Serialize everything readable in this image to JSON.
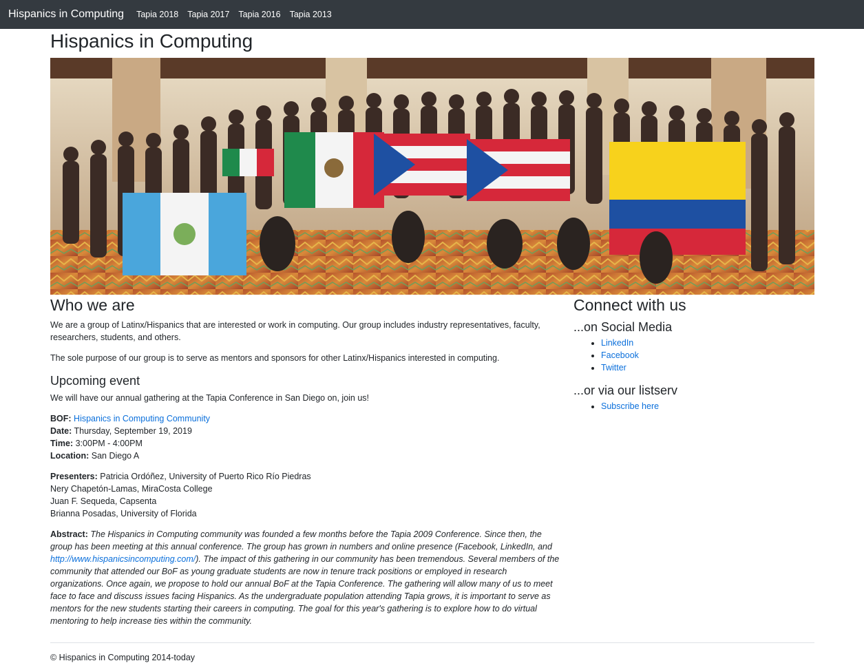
{
  "nav": {
    "brand": "Hispanics in Computing",
    "links": [
      "Tapia 2018",
      "Tapia 2017",
      "Tapia 2016",
      "Tapia 2013"
    ]
  },
  "page": {
    "title": "Hispanics in Computing"
  },
  "hero": {
    "description": "Group photo holding flags"
  },
  "who": {
    "heading": "Who we are",
    "p1": "We are a group of Latinx/Hispanics that are interested or work in computing. Our group includes industry representatives, faculty, researchers, students, and others.",
    "p2": "The sole purpose of our group is to serve as mentors and sponsors for other Latinx/Hispanics interested in computing."
  },
  "event": {
    "heading": "Upcoming event",
    "intro": "We will have our annual gathering at the Tapia Conference in San Diego on, join us!",
    "bof_label": "BOF:",
    "bof_link": "Hispanics in Computing Community",
    "date_label": "Date:",
    "date": "Thursday, September 19, 2019",
    "time_label": "Time:",
    "time": "3:00PM - 4:00PM",
    "location_label": "Location:",
    "location": "San Diego A",
    "presenters_label": "Presenters:",
    "presenters": [
      "Patricia Ordóñez, University of Puerto Rico Río Piedras",
      "Nery Chapetón-Lamas, MiraCosta College",
      "Juan F. Sequeda, Capsenta",
      "Brianna Posadas, University of Florida"
    ],
    "abstract_label": "Abstract:",
    "abstract_before": "The Hispanics in Computing community was founded a few months before the Tapia 2009 Conference. Since then, the group has been meeting at this annual conference. The group has grown in numbers and online presence (Facebook, LinkedIn, and ",
    "abstract_link": "http://www.hispanicsincomputing.com/",
    "abstract_after": "). The impact of this gathering in our community has been tremendous. Several members of the community that attended our BoF as young graduate students are now in tenure track positions or employed in research organizations. Once again, we propose to hold our annual BoF at the Tapia Conference. The gathering will allow many of us to meet face to face and discuss issues facing Hispanics. As the undergraduate population attending Tapia grows, it is important to serve as mentors for the new students starting their careers in computing. The goal for this year's gathering is to explore how to do virtual mentoring to help increase ties within the community."
  },
  "connect": {
    "heading": "Connect with us",
    "social_heading": "...on Social Media",
    "social": [
      "LinkedIn",
      "Facebook",
      "Twitter"
    ],
    "listserv_heading": "...or via our listserv",
    "listserv": [
      "Subscribe here"
    ]
  },
  "footer": {
    "text": "© Hispanics in Computing 2014-today"
  },
  "colors": {
    "navbar": "#343a40",
    "link": "#0a6fdb",
    "text": "#212529"
  }
}
